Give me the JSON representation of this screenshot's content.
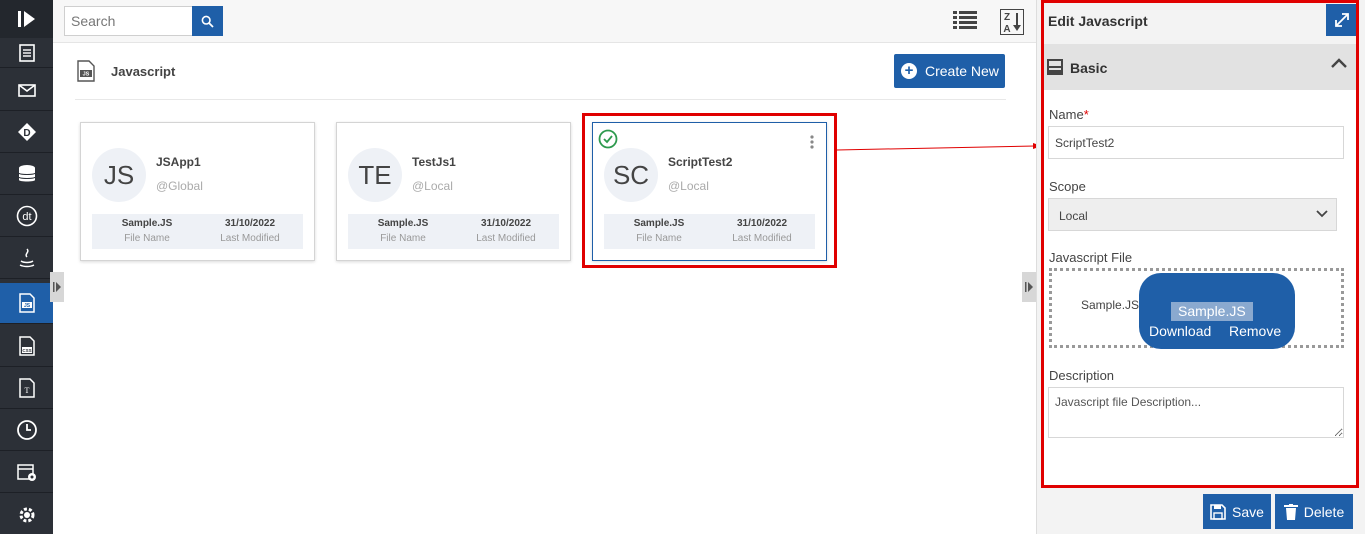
{
  "search": {
    "placeholder": "Search"
  },
  "page": {
    "title": "Javascript",
    "create_label": "Create New"
  },
  "cards": [
    {
      "initials": "JS",
      "name": "JSApp1",
      "scope": "@Global",
      "file_name": "Sample.JS",
      "file_name_label": "File Name",
      "modified": "31/10/2022",
      "modified_label": "Last Modified"
    },
    {
      "initials": "TE",
      "name": "TestJs1",
      "scope": "@Local",
      "file_name": "Sample.JS",
      "file_name_label": "File Name",
      "modified": "31/10/2022",
      "modified_label": "Last Modified"
    },
    {
      "initials": "SC",
      "name": "ScriptTest2",
      "scope": "@Local",
      "file_name": "Sample.JS",
      "file_name_label": "File Name",
      "modified": "31/10/2022",
      "modified_label": "Last Modified",
      "selected": true
    }
  ],
  "panel": {
    "title": "Edit Javascript",
    "section": "Basic",
    "name_label": "Name",
    "required_mark": "*",
    "name_value": "ScriptTest2",
    "scope_label": "Scope",
    "scope_value": "Local",
    "file_label": "Javascript File",
    "file_text": "Sample.JS",
    "file_pill_name": "Sample.JS",
    "download_label": "Download",
    "remove_label": "Remove",
    "description_label": "Description",
    "description_placeholder": "Javascript file Description...",
    "save_label": "Save",
    "delete_label": "Delete"
  },
  "sidebar": {
    "icons": [
      "logo-icon",
      "document-icon",
      "mail-icon",
      "diamond-d-icon",
      "database-icon",
      "dt-icon",
      "java-icon",
      "js-file-icon",
      "css-file-icon",
      "text-file-icon",
      "clock-icon",
      "calendar-settings-icon",
      "gear-icon"
    ],
    "active_index": 7
  },
  "colors": {
    "accent": "#1f5fa8",
    "rail": "#2c3037",
    "highlight": "#e00000",
    "success": "#2e9a4e"
  }
}
